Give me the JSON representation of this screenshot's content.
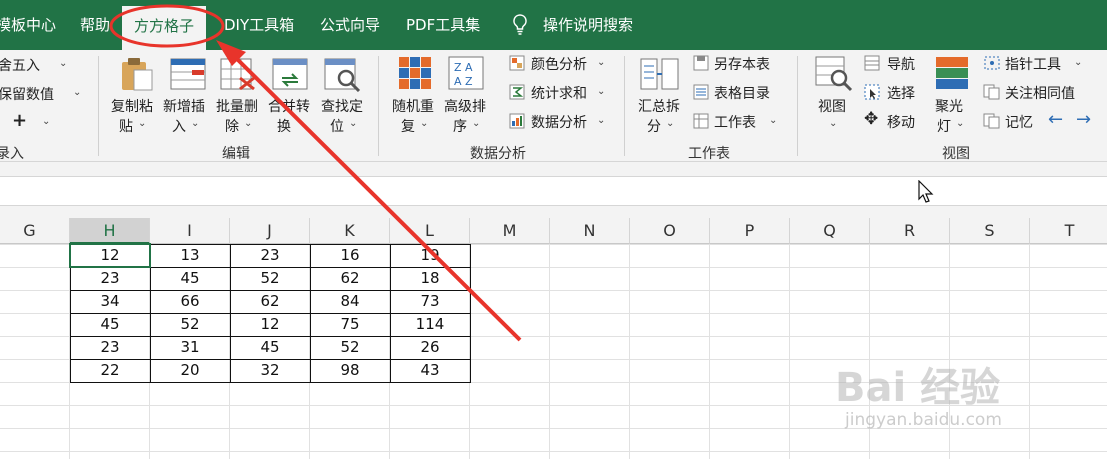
{
  "tabs": [
    "模板中心",
    "帮助",
    "方方格子",
    "DIY工具箱",
    "公式向导",
    "PDF工具集"
  ],
  "tell_me": "操作说明搜索",
  "ribbon": {
    "left_partial": {
      "round": "舍五入",
      "keep": "保留数值",
      "plus": "+",
      "group": "录入"
    },
    "edit": {
      "copy_paste": [
        "复制粘",
        "贴"
      ],
      "insert": [
        "新增插",
        "入"
      ],
      "batch_delete": [
        "批量删",
        "除"
      ],
      "merge_convert": [
        "合并转",
        "换"
      ],
      "find": [
        "查找定",
        "位"
      ],
      "group": "编辑"
    },
    "analysis": {
      "random": [
        "随机重",
        "复"
      ],
      "sort": [
        "高级排",
        "序"
      ],
      "color_analysis": "颜色分析",
      "stats": "统计求和",
      "data_analysis": "数据分析",
      "group": "数据分析"
    },
    "sheet": {
      "summary": [
        "汇总拆",
        "分"
      ],
      "save_as": "另存本表",
      "toc": "表格目录",
      "worksheet": "工作表",
      "group": "工作表"
    },
    "view": {
      "view_btn": "视图",
      "nav": "导航",
      "select": "选择",
      "move": "移动",
      "spotlight": [
        "聚光",
        "灯"
      ],
      "pointer": "指针工具",
      "focus_same": "关注相同值",
      "memory": "记忆",
      "group": "视图"
    }
  },
  "columns": [
    "G",
    "H",
    "I",
    "J",
    "K",
    "L",
    "M",
    "N",
    "O",
    "P",
    "Q",
    "R",
    "S",
    "T"
  ],
  "table": [
    [
      "12",
      "13",
      "23",
      "16",
      "19"
    ],
    [
      "23",
      "45",
      "52",
      "62",
      "18"
    ],
    [
      "34",
      "66",
      "62",
      "84",
      "73"
    ],
    [
      "45",
      "52",
      "12",
      "75",
      "114"
    ],
    [
      "23",
      "31",
      "45",
      "52",
      "26"
    ],
    [
      "22",
      "20",
      "32",
      "98",
      "43"
    ]
  ],
  "watermark": {
    "brand": "Bai 经验",
    "url": "jingyan.baidu.com"
  },
  "colors": {
    "ribbon_green": "#217346",
    "annotation_red": "#e8342b"
  }
}
